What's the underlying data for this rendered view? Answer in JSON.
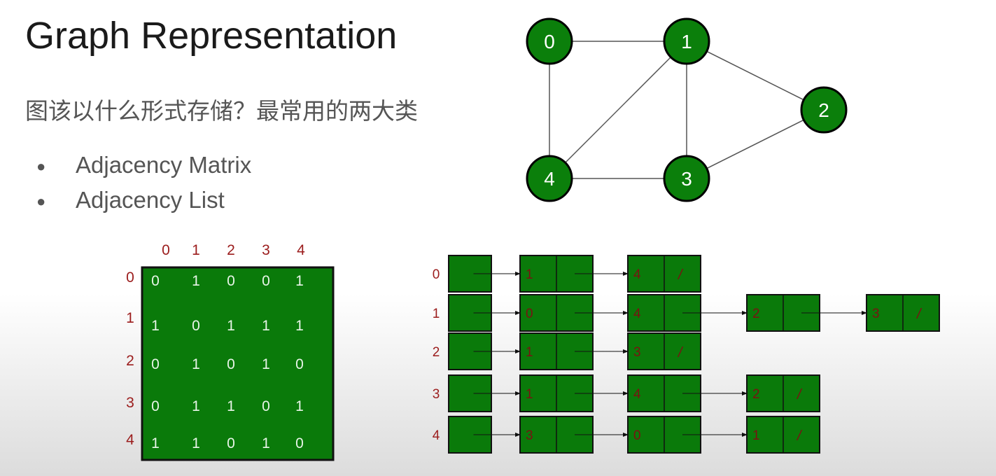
{
  "slide": {
    "title": "Graph Representation",
    "subtitle": "图该以什么形式存储？最常用的两大类",
    "bullets": [
      "Adjacency Matrix",
      "Adjacency List"
    ]
  },
  "colors": {
    "node_fill": "#0b7f0b",
    "cell_fill": "#0a7a0a",
    "index_red": "#9b1c1c",
    "dark_red": "#7a1212",
    "text_gray": "#555555"
  },
  "graph": {
    "nodes": [
      "0",
      "1",
      "2",
      "3",
      "4"
    ],
    "edges": [
      [
        "0",
        "1"
      ],
      [
        "0",
        "4"
      ],
      [
        "1",
        "2"
      ],
      [
        "1",
        "3"
      ],
      [
        "1",
        "4"
      ],
      [
        "2",
        "3"
      ],
      [
        "3",
        "4"
      ]
    ]
  },
  "matrix": {
    "col_headers": [
      "0",
      "1",
      "2",
      "3",
      "4"
    ],
    "row_headers": [
      "0",
      "1",
      "2",
      "3",
      "4"
    ],
    "rows": [
      [
        "0",
        "1",
        "0",
        "0",
        "1"
      ],
      [
        "1",
        "0",
        "1",
        "1",
        "1"
      ],
      [
        "0",
        "1",
        "0",
        "1",
        "0"
      ],
      [
        "0",
        "1",
        "1",
        "0",
        "1"
      ],
      [
        "1",
        "1",
        "0",
        "1",
        "0"
      ]
    ]
  },
  "adjacency_list": {
    "rows": [
      {
        "head": "0",
        "nodes": [
          {
            "v": "1",
            "end": false
          },
          {
            "v": "4",
            "end": true
          }
        ]
      },
      {
        "head": "1",
        "nodes": [
          {
            "v": "0",
            "end": false
          },
          {
            "v": "4",
            "end": false
          },
          {
            "v": "2",
            "end": false
          },
          {
            "v": "3",
            "end": true
          }
        ]
      },
      {
        "head": "2",
        "nodes": [
          {
            "v": "1",
            "end": false
          },
          {
            "v": "3",
            "end": true
          }
        ]
      },
      {
        "head": "3",
        "nodes": [
          {
            "v": "1",
            "end": false
          },
          {
            "v": "4",
            "end": false
          },
          {
            "v": "2",
            "end": true
          }
        ]
      },
      {
        "head": "4",
        "nodes": [
          {
            "v": "3",
            "end": false
          },
          {
            "v": "0",
            "end": false
          },
          {
            "v": "1",
            "end": true
          }
        ]
      }
    ],
    "null_marker": "/"
  }
}
